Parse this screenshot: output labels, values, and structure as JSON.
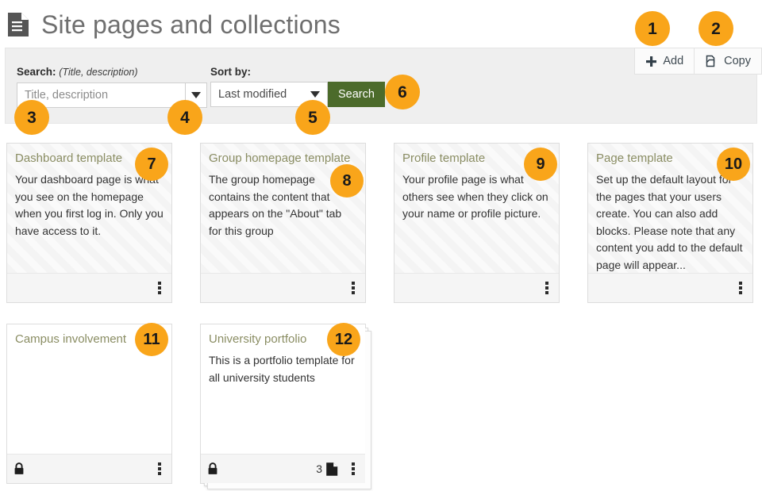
{
  "header": {
    "title": "Site pages and collections",
    "icon": "document-icon"
  },
  "actions": [
    {
      "label": "Add",
      "icon": "plus-icon"
    },
    {
      "label": "Copy",
      "icon": "copy-icon"
    }
  ],
  "search": {
    "search_label": "Search:",
    "search_hint": "(Title, description)",
    "input_placeholder": "Title, description",
    "input_value": "",
    "dropdown_icon": "chevron-down-icon",
    "sort_label": "Sort by:",
    "sort_value": "Last modified",
    "submit_label": "Search"
  },
  "cards": [
    {
      "title": "Dashboard template",
      "description": "Your dashboard page is what you see on the homepage when you first log in. Only you have access to it.",
      "striped": true,
      "locked": false,
      "page_count": "",
      "collection": false,
      "menu_icon": "kebab-menu-icon"
    },
    {
      "title": "Group homepage template",
      "description": "The group homepage contains the content that appears on the \"About\" tab for this group",
      "striped": true,
      "locked": false,
      "page_count": "",
      "collection": false,
      "menu_icon": "kebab-menu-icon"
    },
    {
      "title": "Profile template",
      "description": "Your profile page is what others see when they click on your name or profile picture.",
      "striped": true,
      "locked": false,
      "page_count": "",
      "collection": false,
      "menu_icon": "kebab-menu-icon"
    },
    {
      "title": "Page template",
      "description": "Set up the default layout for the pages that your users create. You can also add blocks. Please note that any content you add to the default page will appear...",
      "striped": true,
      "locked": false,
      "page_count": "",
      "collection": false,
      "menu_icon": "kebab-menu-icon"
    },
    {
      "title": "Campus involvement",
      "description": "",
      "striped": false,
      "locked": true,
      "page_count": "",
      "collection": false,
      "menu_icon": "kebab-menu-icon"
    },
    {
      "title": "University portfolio",
      "description": "This is a portfolio template for all university students",
      "striped": false,
      "locked": true,
      "page_count": "3",
      "collection": true,
      "menu_icon": "kebab-menu-icon"
    }
  ],
  "callouts": [
    {
      "number": "1"
    },
    {
      "number": "2"
    },
    {
      "number": "3"
    },
    {
      "number": "4"
    },
    {
      "number": "5"
    },
    {
      "number": "6"
    },
    {
      "number": "7"
    },
    {
      "number": "8"
    },
    {
      "number": "9"
    },
    {
      "number": "10"
    },
    {
      "number": "11"
    },
    {
      "number": "12"
    }
  ],
  "colors": {
    "accent_orange": "#f9a51a",
    "search_button_green": "#4c6b2b",
    "card_title": "#8a8d63",
    "panel_bg": "#efefef"
  }
}
